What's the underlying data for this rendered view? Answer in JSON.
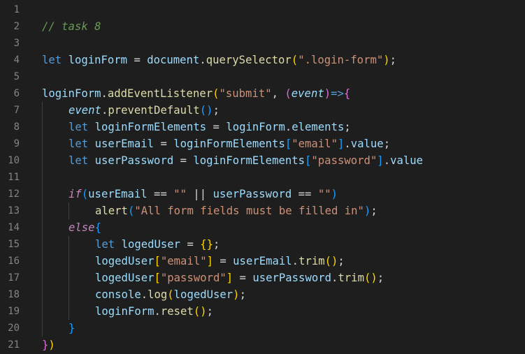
{
  "editor": {
    "lines": [
      {
        "num": "1",
        "indent": 0,
        "tokens": []
      },
      {
        "num": "2",
        "indent": 0,
        "tokens": [
          [
            "cmt",
            "// task 8"
          ]
        ]
      },
      {
        "num": "3",
        "indent": 0,
        "tokens": []
      },
      {
        "num": "4",
        "indent": 0,
        "tokens": [
          [
            "kw",
            "let"
          ],
          [
            "op",
            " "
          ],
          [
            "var",
            "loginForm"
          ],
          [
            "op",
            " = "
          ],
          [
            "var",
            "document"
          ],
          [
            "op",
            "."
          ],
          [
            "fn",
            "querySelector"
          ],
          [
            "b1",
            "("
          ],
          [
            "str",
            "\".login-form\""
          ],
          [
            "b1",
            ")"
          ],
          [
            "op",
            ";"
          ]
        ]
      },
      {
        "num": "5",
        "indent": 0,
        "tokens": []
      },
      {
        "num": "6",
        "indent": 0,
        "tokens": [
          [
            "var",
            "loginForm"
          ],
          [
            "op",
            "."
          ],
          [
            "fn",
            "addEventListener"
          ],
          [
            "b1",
            "("
          ],
          [
            "str",
            "\"submit\""
          ],
          [
            "op",
            ", "
          ],
          [
            "b2",
            "("
          ],
          [
            "param",
            "event"
          ],
          [
            "b2",
            ")"
          ],
          [
            "kw",
            "=>"
          ],
          [
            "b2",
            "{"
          ]
        ]
      },
      {
        "num": "7",
        "indent": 1,
        "tokens": [
          [
            "param",
            "event"
          ],
          [
            "op",
            "."
          ],
          [
            "fn",
            "preventDefault"
          ],
          [
            "b3",
            "()"
          ],
          [
            "op",
            ";"
          ]
        ]
      },
      {
        "num": "8",
        "indent": 1,
        "tokens": [
          [
            "kw",
            "let"
          ],
          [
            "op",
            " "
          ],
          [
            "var",
            "loginFormElements"
          ],
          [
            "op",
            " = "
          ],
          [
            "var",
            "loginForm"
          ],
          [
            "op",
            "."
          ],
          [
            "var",
            "elements"
          ],
          [
            "op",
            ";"
          ]
        ]
      },
      {
        "num": "9",
        "indent": 1,
        "tokens": [
          [
            "kw",
            "let"
          ],
          [
            "op",
            " "
          ],
          [
            "var",
            "userEmail"
          ],
          [
            "op",
            " = "
          ],
          [
            "var",
            "loginFormElements"
          ],
          [
            "b3",
            "["
          ],
          [
            "str",
            "\"email\""
          ],
          [
            "b3",
            "]"
          ],
          [
            "op",
            "."
          ],
          [
            "var",
            "value"
          ],
          [
            "op",
            ";"
          ]
        ]
      },
      {
        "num": "10",
        "indent": 1,
        "tokens": [
          [
            "kw",
            "let"
          ],
          [
            "op",
            " "
          ],
          [
            "var",
            "userPassword"
          ],
          [
            "op",
            " = "
          ],
          [
            "var",
            "loginFormElements"
          ],
          [
            "b3",
            "["
          ],
          [
            "str",
            "\"password\""
          ],
          [
            "b3",
            "]"
          ],
          [
            "op",
            "."
          ],
          [
            "var",
            "value"
          ]
        ]
      },
      {
        "num": "11",
        "indent": 1,
        "tokens": []
      },
      {
        "num": "12",
        "indent": 1,
        "tokens": [
          [
            "ctl",
            "if"
          ],
          [
            "b3",
            "("
          ],
          [
            "var",
            "userEmail"
          ],
          [
            "op",
            " == "
          ],
          [
            "str",
            "\"\""
          ],
          [
            "op",
            " || "
          ],
          [
            "var",
            "userPassword"
          ],
          [
            "op",
            " == "
          ],
          [
            "str",
            "\"\""
          ],
          [
            "b3",
            ")"
          ]
        ]
      },
      {
        "num": "13",
        "indent": 2,
        "tokens": [
          [
            "fn",
            "alert"
          ],
          [
            "b3",
            "("
          ],
          [
            "str",
            "\"All form fields must be filled in\""
          ],
          [
            "b3",
            ")"
          ],
          [
            "op",
            ";"
          ]
        ]
      },
      {
        "num": "14",
        "indent": 1,
        "tokens": [
          [
            "ctl",
            "else"
          ],
          [
            "b3",
            "{"
          ]
        ]
      },
      {
        "num": "15",
        "indent": 2,
        "tokens": [
          [
            "kw",
            "let"
          ],
          [
            "op",
            " "
          ],
          [
            "var",
            "logedUser"
          ],
          [
            "op",
            " = "
          ],
          [
            "b1",
            "{}"
          ],
          [
            "op",
            ";"
          ]
        ]
      },
      {
        "num": "16",
        "indent": 2,
        "tokens": [
          [
            "var",
            "logedUser"
          ],
          [
            "b1",
            "["
          ],
          [
            "str",
            "\"email\""
          ],
          [
            "b1",
            "]"
          ],
          [
            "op",
            " = "
          ],
          [
            "var",
            "userEmail"
          ],
          [
            "op",
            "."
          ],
          [
            "fn",
            "trim"
          ],
          [
            "b1",
            "()"
          ],
          [
            "op",
            ";"
          ]
        ]
      },
      {
        "num": "17",
        "indent": 2,
        "tokens": [
          [
            "var",
            "logedUser"
          ],
          [
            "b1",
            "["
          ],
          [
            "str",
            "\"password\""
          ],
          [
            "b1",
            "]"
          ],
          [
            "op",
            " = "
          ],
          [
            "var",
            "userPassword"
          ],
          [
            "op",
            "."
          ],
          [
            "fn",
            "trim"
          ],
          [
            "b1",
            "()"
          ],
          [
            "op",
            ";"
          ]
        ]
      },
      {
        "num": "18",
        "indent": 2,
        "tokens": [
          [
            "var",
            "console"
          ],
          [
            "op",
            "."
          ],
          [
            "fn",
            "log"
          ],
          [
            "b1",
            "("
          ],
          [
            "var",
            "logedUser"
          ],
          [
            "b1",
            ")"
          ],
          [
            "op",
            ";"
          ]
        ]
      },
      {
        "num": "19",
        "indent": 2,
        "tokens": [
          [
            "var",
            "loginForm"
          ],
          [
            "op",
            "."
          ],
          [
            "fn",
            "reset"
          ],
          [
            "b1",
            "()"
          ],
          [
            "op",
            ";"
          ]
        ]
      },
      {
        "num": "20",
        "indent": 1,
        "tokens": [
          [
            "b3",
            "}"
          ]
        ]
      },
      {
        "num": "21",
        "indent": 0,
        "tokens": [
          [
            "b2",
            "}"
          ],
          [
            "b1",
            ")"
          ]
        ]
      }
    ]
  }
}
